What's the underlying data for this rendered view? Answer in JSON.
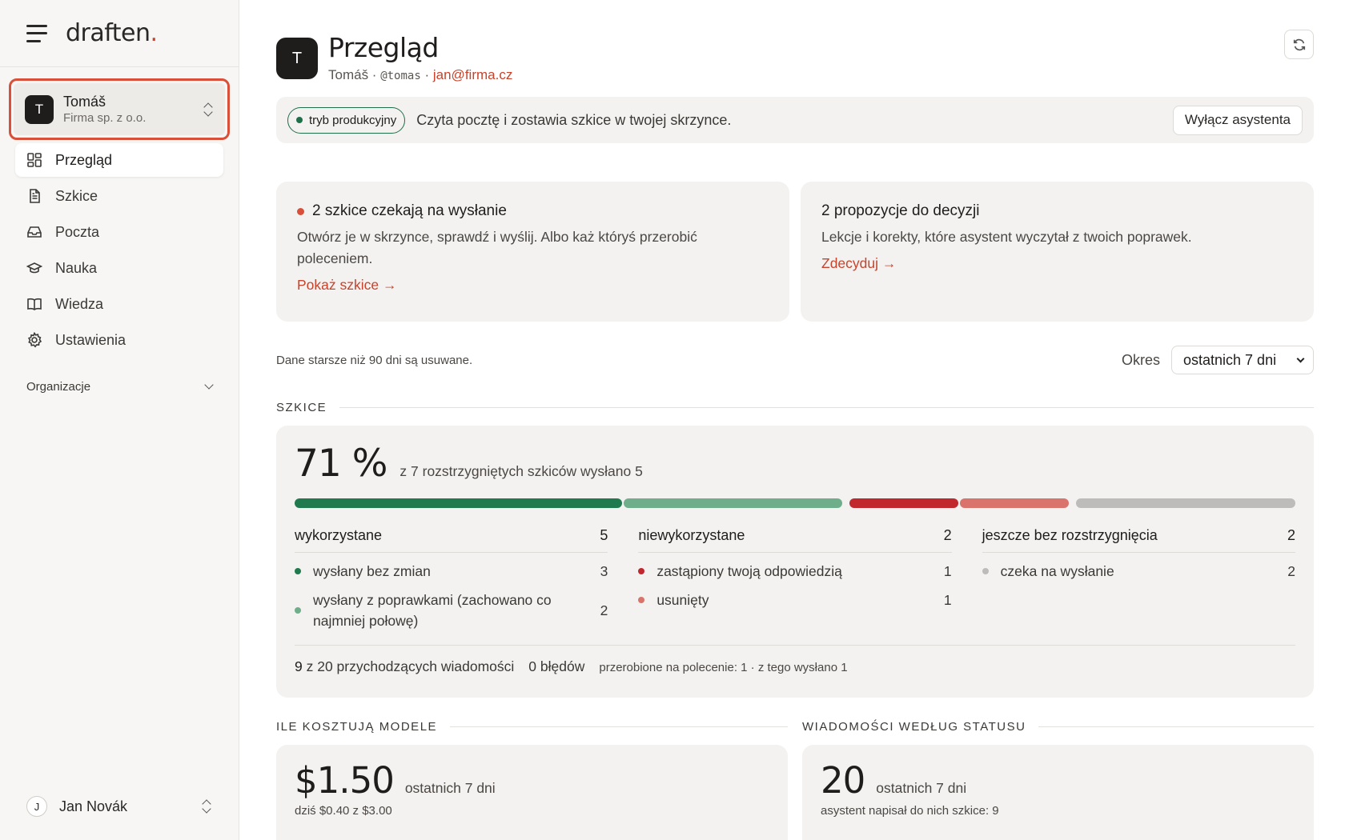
{
  "brand": {
    "name": "draften",
    "dot": "."
  },
  "org": {
    "initial": "T",
    "name": "Tomáš",
    "company": "Firma sp. z o.o."
  },
  "nav": [
    {
      "label": "Przegląd",
      "icon": "dashboard-icon",
      "active": true
    },
    {
      "label": "Szkice",
      "icon": "document-icon"
    },
    {
      "label": "Poczta",
      "icon": "inbox-icon"
    },
    {
      "label": "Nauka",
      "icon": "graduation-cap-icon"
    },
    {
      "label": "Wiedza",
      "icon": "book-icon"
    },
    {
      "label": "Ustawienia",
      "icon": "gear-icon"
    }
  ],
  "org_section": "Organizacje",
  "user": {
    "initial": "J",
    "name": "Jan Novák"
  },
  "header": {
    "initial": "T",
    "title": "Przegląd",
    "name": "Tomáš",
    "sep": " · ",
    "handle": "@tomas",
    "email": "jan@firma.cz"
  },
  "banner": {
    "mode": "tryb produkcyjny",
    "text": "Czyta pocztę i zostawia szkice w twojej skrzynce.",
    "button": "Wyłącz asystenta"
  },
  "cards": [
    {
      "title": "2 szkice czekają na wysłanie",
      "text": "Otwórz je w skrzynce, sprawdź i wyślij. Albo każ któryś przerobić poleceniem.",
      "link": "Pokaż szkice →"
    },
    {
      "title": "2 propozycje do decyzji",
      "text": "Lekcje i korekty, które asystent wyczytał z twoich poprawek.",
      "link": "Zdecyduj →"
    }
  ],
  "retention": "Dane starsze niż 90 dni są usuwane.",
  "period": {
    "label": "Okres",
    "value": "ostatnich 7 dni"
  },
  "drafts": {
    "section": "SZKICE",
    "percent": "71 %",
    "summary": "z 7 rozstrzygniętych szkiców wysłano 5",
    "bar": [
      {
        "group": "used",
        "value": 3,
        "color": "#1f7a4d"
      },
      {
        "group": "used",
        "value": 2,
        "color": "#6fae8a"
      },
      {
        "group": "unused",
        "value": 1,
        "color": "#c1272d"
      },
      {
        "group": "unused",
        "value": 1,
        "color": "#d9736c"
      },
      {
        "group": "pending",
        "value": 2,
        "color": "#bdbcba"
      }
    ],
    "columns": [
      {
        "title": "wykorzystane",
        "count": "5",
        "rows": [
          {
            "label": "wysłany bez zmian",
            "count": "3",
            "color": "#1f7a4d"
          },
          {
            "label": "wysłany z poprawkami (zachowano co najmniej połowę)",
            "count": "2",
            "color": "#6fae8a"
          }
        ]
      },
      {
        "title": "niewykorzystane",
        "count": "2",
        "rows": [
          {
            "label": "zastąpiony twoją odpowiedzią",
            "count": "1",
            "color": "#c1272d"
          },
          {
            "label": "usunięty",
            "count": "1",
            "color": "#d9736c"
          }
        ]
      },
      {
        "title": "jeszcze bez rozstrzygnięcia",
        "count": "2",
        "rows": [
          {
            "label": "czeka na wysłanie",
            "count": "2",
            "color": "#bdbcba"
          }
        ]
      }
    ],
    "footer": {
      "num": "9",
      "text": " z 20 przychodzących wiadomości",
      "errors": "0 błędów",
      "rework": "przerobione na polecenie: 1 · z tego wysłano 1"
    }
  },
  "costs": {
    "section": "ILE KOSZTUJĄ MODELE",
    "value": "$1.50",
    "period": "ostatnich 7 dni",
    "note": "dziś $0.40 z $3.00"
  },
  "messages": {
    "section": "WIADOMOŚCI WEDŁUG STATUSU",
    "value": "20",
    "period": "ostatnich 7 dni",
    "note": "asystent napisał do nich szkice: 9"
  }
}
